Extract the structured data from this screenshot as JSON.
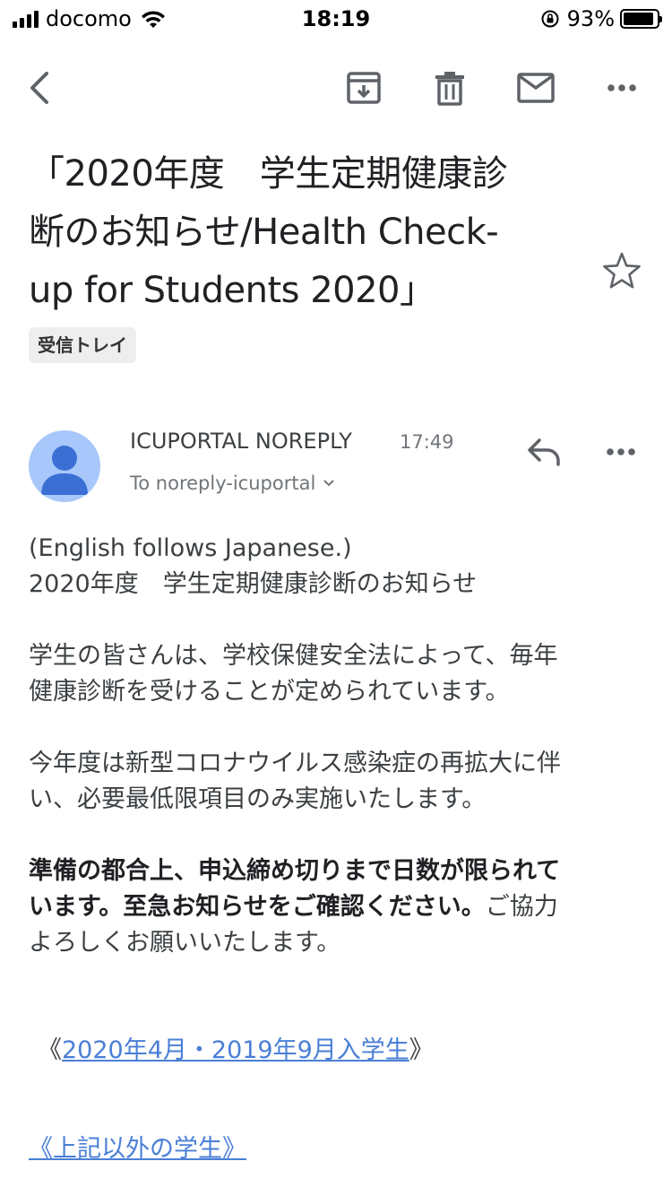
{
  "status_bar": {
    "carrier": "docomo",
    "time": "18:19",
    "battery_percent": "93%",
    "battery_level": 0.93
  },
  "toolbar": {
    "icons": [
      "back-icon",
      "archive-icon",
      "trash-icon",
      "mail-icon",
      "more-icon"
    ]
  },
  "email": {
    "subject_line1": "「2020年度　学生定期健康診",
    "subject_line2": "断のお知らせ/Health Check-",
    "subject_line3": "up for Students 2020」",
    "label": "受信トレイ",
    "sender_name": "ICUPORTAL NOREPLY",
    "sent_time": "17:49",
    "recipient": "To noreply-icuportal",
    "body": {
      "line1": "(English follows Japanese.)",
      "line2": "2020年度　学生定期健康診断のお知らせ",
      "para2_line1": "学生の皆さんは、学校保健安全法によって、毎年",
      "para2_line2": "健康診断を受けることが定められています。",
      "para3_line1": "今年度は新型コロナウイルス感染症の再拡大に伴",
      "para3_line2": "い、必要最低限項目のみ実施いたします。",
      "para4_bold1": "準備の都合上、申込締め切りまで日数が限られて",
      "para4_bold2": "います。至急お知らせをご確認ください。",
      "para4_rest": "ご協力",
      "para4_line3": "よろしくお願いいたします。",
      "link1_open": "《",
      "link1_text": "2020年4月・2019年9月入学生",
      "link1_close": "》",
      "link2_text": "《上記以外の学生》"
    }
  },
  "colors": {
    "link": "#4a7fd6",
    "avatar_bg": "#a8c7fa",
    "avatar_fg": "#3b6fd4",
    "icon_gray": "#5f6368"
  }
}
